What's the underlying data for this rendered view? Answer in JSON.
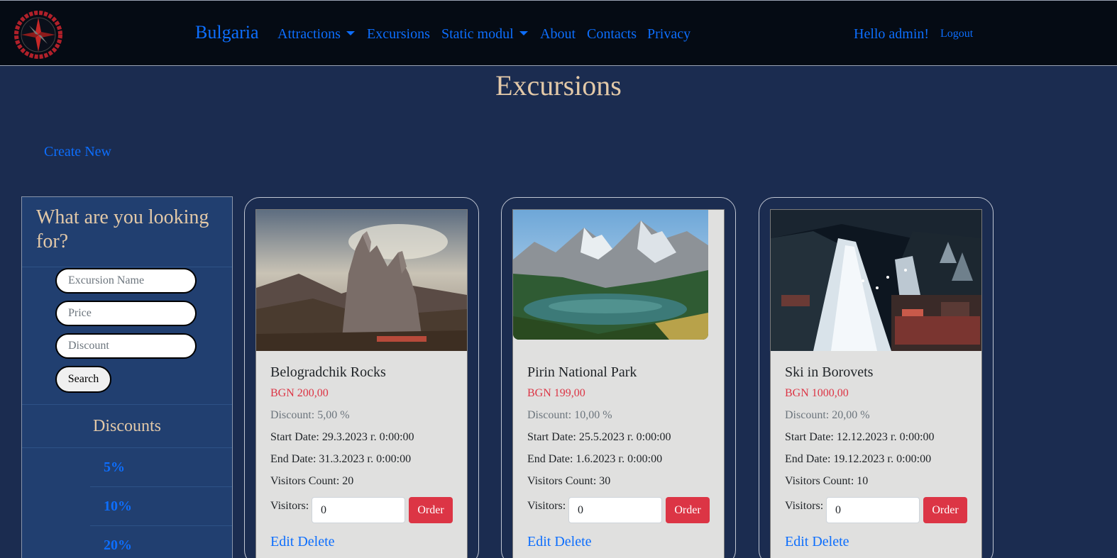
{
  "navbar": {
    "brand": "Bulgaria",
    "items": [
      {
        "label": "Attractions",
        "dropdown": true
      },
      {
        "label": "Excursions",
        "dropdown": false
      },
      {
        "label": "Static modul",
        "dropdown": true
      },
      {
        "label": "About",
        "dropdown": false
      },
      {
        "label": "Contacts",
        "dropdown": false
      },
      {
        "label": "Privacy",
        "dropdown": false
      }
    ],
    "greeting": "Hello admin!",
    "logout": "Logout"
  },
  "page": {
    "title": "Excursions",
    "create_new": "Create New"
  },
  "sidebar": {
    "title": "What are you looking for?",
    "search": {
      "name_placeholder": "Excursion Name",
      "price_placeholder": "Price",
      "discount_placeholder": "Discount",
      "button": "Search"
    },
    "discounts_title": "Discounts",
    "discounts": [
      "5%",
      "10%",
      "20%"
    ]
  },
  "excursions": [
    {
      "name": "Belogradchik Rocks",
      "price": "BGN 200,00",
      "discount": "Discount: 5,00 %",
      "start": "Start Date: 29.3.2023 г. 0:00:00",
      "end": "End Date: 31.3.2023 г. 0:00:00",
      "visitors_count": "Visitors Count: 20",
      "visitors_label": "Visitors:",
      "visitors_value": "0",
      "order": "Order",
      "edit": "Edit",
      "delete": "Delete"
    },
    {
      "name": "Pirin National Park",
      "price": "BGN 199,00",
      "discount": "Discount: 10,00 %",
      "start": "Start Date: 25.5.2023 г. 0:00:00",
      "end": "End Date: 1.6.2023 г. 0:00:00",
      "visitors_count": "Visitors Count: 30",
      "visitors_label": "Visitors:",
      "visitors_value": "0",
      "order": "Order",
      "edit": "Edit",
      "delete": "Delete"
    },
    {
      "name": "Ski in Borovets",
      "price": "BGN 1000,00",
      "discount": "Discount: 20,00 %",
      "start": "Start Date: 12.12.2023 г. 0:00:00",
      "end": "End Date: 19.12.2023 г. 0:00:00",
      "visitors_count": "Visitors Count: 10",
      "visitors_label": "Visitors:",
      "visitors_value": "0",
      "order": "Order",
      "edit": "Edit",
      "delete": "Delete"
    }
  ]
}
